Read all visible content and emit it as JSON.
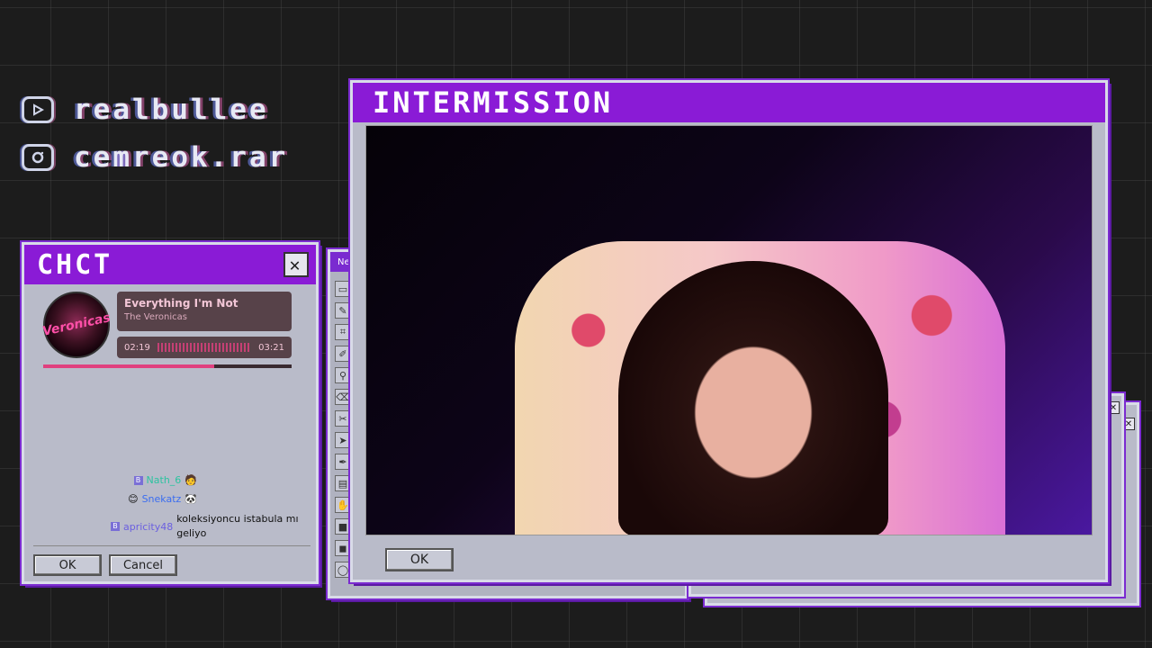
{
  "social": [
    {
      "icon": "youtube-icon",
      "handle": "REALBULLEE"
    },
    {
      "icon": "instagram-icon",
      "handle": "cEmREOK.RAR"
    }
  ],
  "chat_window": {
    "title": "CHCT",
    "close_label": "✕",
    "now_playing": {
      "album_text": "Veronicas",
      "song": "Everything I'm Not",
      "artist": "The Veronicas",
      "elapsed": "02:19",
      "duration": "03:21",
      "progress_fraction": 0.69
    },
    "messages": [
      {
        "badge": "B",
        "user": "Nath_6",
        "text": "",
        "emote": "🧑"
      },
      {
        "badge": "😊",
        "user": "Snekatz",
        "text": "",
        "emote": "🐼"
      },
      {
        "badge": "B",
        "user": "apricity48",
        "text": "koleksiyoncu istabula mı geliyo",
        "emote": ""
      }
    ],
    "ok_label": "OK",
    "cancel_label": "Cancel"
  },
  "paint_window": {
    "title": "Ne",
    "tools": [
      "▭",
      "✎",
      "⌗",
      "✐",
      "⚲",
      "⌫",
      "✂",
      "➤",
      "✒",
      "▤",
      "✋",
      "■",
      "◼",
      "◯"
    ]
  },
  "main_window": {
    "title": "INTERMISSION",
    "ok_label": "OK"
  },
  "colors": {
    "accent": "#8a1bd6",
    "window_bg": "#b9bbc9",
    "music_pink": "#e0407f"
  }
}
